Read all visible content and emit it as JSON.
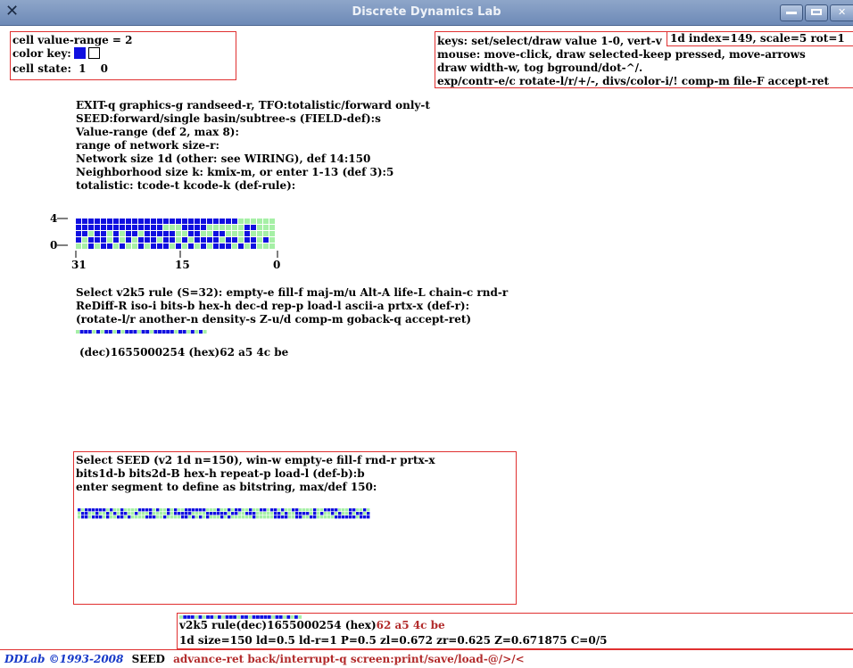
{
  "window": {
    "title": "Discrete Dynamics Lab"
  },
  "info_box": {
    "value_range": "cell value-range = 2",
    "color_key_label": "color key:",
    "cell_state_label": "cell state:",
    "state_1": "1",
    "state_0": "0",
    "colors": {
      "state_1": "#1010e0",
      "state_0": "#ffffff"
    }
  },
  "keys_box": {
    "lines": [
      "keys: set/select/draw value 1-0, vert-v",
      "mouse: move-click, draw selected-keep pressed, move-arrows",
      "draw width-w, tog bground/dot-^/.",
      "exp/contr-e/c rotate-l/r/+/-, divs/color-i/! comp-m file-F accept-ret"
    ]
  },
  "index_box": {
    "text": "1d index=149, scale=5 rot=1"
  },
  "menu1": {
    "lines": [
      "EXIT-q graphics-g randseed-r, TFO:totalistic/forward only-t",
      "SEED:forward/single basin/subtree-s (FIELD-def):s",
      "Value-range (def 2, max 8):",
      "range of network size-r:",
      "Network size 1d (other: see WIRING), def 14:150",
      "Neighborhood size k: kmix-m, or enter 1-13 (def 3):5",
      "totalistic: tcode-t kcode-k (def-rule):"
    ]
  },
  "rule_table": {
    "y_top": "4",
    "y_bottom": "0",
    "x_labels": [
      "31",
      "15",
      "0"
    ],
    "colors": {
      "on": "#1010e0",
      "off": "#a6f0a6"
    }
  },
  "menu2": {
    "lines": [
      "Select v2k5 rule (S=32): empty-e fill-f maj-m/u Alt-A life-L chain-c rnd-r",
      "ReDiff-R iso-i bits-b hex-h dec-d rep-p load-l ascii-a prtx-x (def-r):",
      "(rotate-l/r another-n density-s Z-u/d comp-m goback-q accept-ret)"
    ],
    "rule_value": "(dec)1655000254 (hex)62 a5 4c be"
  },
  "seed_box": {
    "lines": [
      "Select SEED (v2 1d n=150), win-w empty-e fill-f rnd-r prtx-x",
      "bits1d-b bits2d-B hex-h repeat-p load-l (def-b):b",
      "enter segment to define as bitstring, max/def 150:"
    ]
  },
  "status_box": {
    "rule_prefix": "v2k5 rule(dec)1655000254  (hex)",
    "rule_hex": "62 a5 4c be",
    "stats": "1d size=150 ld=0.5 ld-r=1 P=0.5 zl=0.672 zr=0.625 Z=0.671875 C=0/5"
  },
  "bottom_bar": {
    "brand": "DDLab ©1993-2008",
    "mode": "SEED",
    "hint": "advance-ret back/interrupt-q  screen:print/save/load-@/>/<"
  }
}
